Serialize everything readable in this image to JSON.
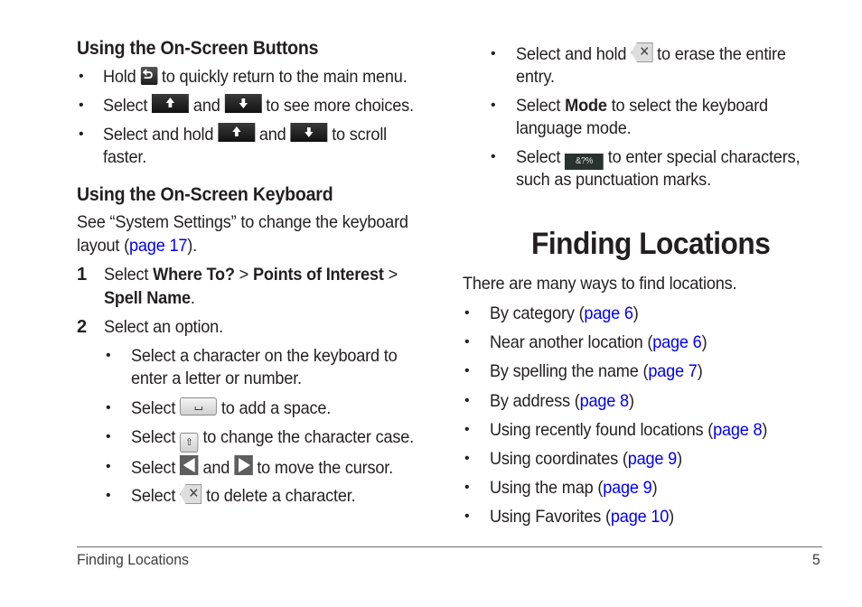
{
  "left_column": {
    "buttons_section": {
      "heading": "Using the On-Screen Buttons",
      "items": [
        {
          "pre": "Hold",
          "icon1": "back-icon",
          "post": "to quickly return to the main menu."
        },
        {
          "pre": "Select",
          "icon1": "up-arrow-icon",
          "mid": "and",
          "icon2": "down-arrow-icon",
          "post": "to see more choices."
        },
        {
          "pre": "Select and hold",
          "icon1": "up-arrow-icon",
          "mid": "and",
          "icon2": "down-arrow-icon",
          "post": "to scroll",
          "post_line2": "faster."
        }
      ]
    },
    "keyboard_section": {
      "heading": "Using the On-Screen Keyboard",
      "intro_line1": "See “System Settings” to change the keyboard",
      "intro_line2_pre": "layout (",
      "intro_link": "page 17",
      "intro_line2_post": ").",
      "steps": [
        {
          "number": "1",
          "pre": "Select",
          "b1": "Where To?",
          "sep1": ">",
          "b2": "Points of Interest",
          "sep2": ">",
          "b3": "Spell Name",
          "post": "."
        },
        {
          "number": "2",
          "text": "Select an option."
        }
      ],
      "sub_items": [
        {
          "line1": "Select a character on the keyboard to",
          "line2": "enter a letter or number."
        },
        {
          "pre": "Select",
          "icon1": "space-key-icon",
          "post": "to add a space."
        },
        {
          "pre": "Select",
          "icon1": "shift-key-icon",
          "post": "to change the character case."
        },
        {
          "pre": "Select",
          "icon1": "cursor-left-icon",
          "mid": "and",
          "icon2": "cursor-right-icon",
          "post": "to move the cursor."
        },
        {
          "pre": "Select",
          "icon1": "backspace-icon",
          "post": "to delete a character."
        }
      ],
      "shift_glyph": "⇧"
    }
  },
  "right_column": {
    "keyboard_items": [
      {
        "pre": "Select and hold",
        "icon1": "backspace-icon",
        "post": "to erase the entire",
        "post_line2": "entry."
      },
      {
        "pre": "Select",
        "bold": "Mode",
        "post": "to select the keyboard",
        "post_line2": "language mode."
      },
      {
        "pre": "Select",
        "icon1": "special-characters-icon",
        "icon_label": "&?%",
        "post": "to enter special characters,",
        "post_line2": "such as punctuation marks."
      }
    ],
    "finding_section": {
      "title": "Finding Locations",
      "intro": "There are many ways to find locations.",
      "items": [
        {
          "text": "By category",
          "link": "page 6"
        },
        {
          "text": "Near another location",
          "link": "page 6"
        },
        {
          "text": "By spelling the name",
          "link": "page 7"
        },
        {
          "text": "By address",
          "link": "page 8"
        },
        {
          "text": "Using recently found locations",
          "link": "page 8"
        },
        {
          "text": "Using coordinates",
          "link": "page 9"
        },
        {
          "text": "Using the map",
          "link": "page 9"
        },
        {
          "text": "Using Favorites",
          "link": "page 10"
        }
      ]
    }
  },
  "footer": {
    "section": "Finding Locations",
    "page_number": "5"
  },
  "colors": {
    "text": "#231f20",
    "link": "#0000ee",
    "rule": "#6d6e71"
  }
}
